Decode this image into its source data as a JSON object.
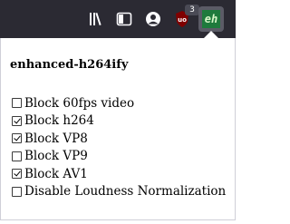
{
  "toolbar": {
    "icons": [
      "library-icon",
      "sidebar-icon",
      "account-icon",
      "ublock-icon",
      "extension-icon"
    ],
    "ublock_badge": "3",
    "extension_logo": "eh",
    "background_color": "#2b2a33",
    "extension_color": "#1e7a3c"
  },
  "popup": {
    "title": "enhanced-h264ify",
    "options": [
      {
        "label": "Block 60fps video",
        "checked": false
      },
      {
        "label": "Block h264",
        "checked": true
      },
      {
        "label": "Block VP8",
        "checked": true
      },
      {
        "label": "Block VP9",
        "checked": false
      },
      {
        "label": "Block AV1",
        "checked": true
      },
      {
        "label": "Disable Loudness Normalization",
        "checked": false
      }
    ]
  }
}
